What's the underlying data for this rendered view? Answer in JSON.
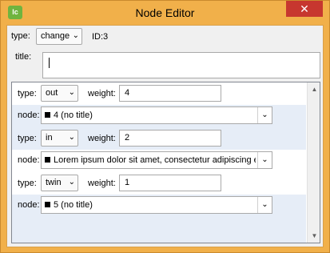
{
  "window": {
    "title": "Node Editor",
    "icon_text": "lc",
    "close_glyph": "✕"
  },
  "header": {
    "type_label": "type:",
    "type_value": "change",
    "id_text": "ID:3",
    "title_label": "title:",
    "title_value": ""
  },
  "links": [
    {
      "type_label": "type:",
      "type_value": "out",
      "weight_label": "weight:",
      "weight_value": "4",
      "node_label": "node:",
      "node_value": "4 (no title)"
    },
    {
      "type_label": "type:",
      "type_value": "in",
      "weight_label": "weight:",
      "weight_value": "2",
      "node_label": "node:",
      "node_value": "Lorem ipsum dolor sit amet, consectetur adipiscing elit"
    },
    {
      "type_label": "type:",
      "type_value": "twin",
      "weight_label": "weight:",
      "weight_value": "1",
      "node_label": "node:",
      "node_value": "5 (no title)"
    }
  ],
  "colors": {
    "titlebar": "#f1b04a",
    "close": "#c7372f",
    "row_alt": "#e6edf7"
  }
}
